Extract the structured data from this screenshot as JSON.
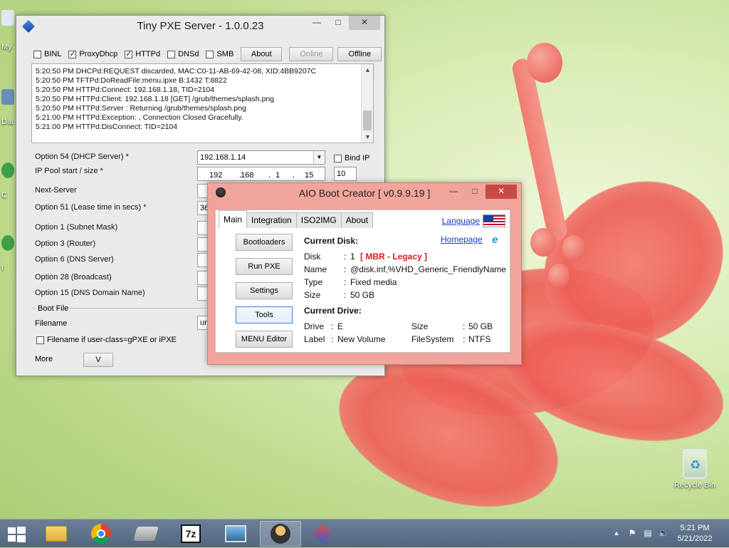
{
  "desktop": {
    "recycle_bin_label": "Recycle Bin",
    "left_fragments": [
      "My",
      "Dat",
      "C",
      "C",
      "I",
      "D"
    ]
  },
  "pxe_window": {
    "title": "Tiny PXE Server - 1.0.0.23",
    "toolbar": {
      "checkboxes": [
        {
          "label": "BINL",
          "checked": false
        },
        {
          "label": "ProxyDhcp",
          "checked": true
        },
        {
          "label": "HTTPd",
          "checked": true
        },
        {
          "label": "DNSd",
          "checked": false
        },
        {
          "label": "SMB",
          "checked": false
        }
      ],
      "about_label": "About",
      "online_label": "Online",
      "offline_label": "Offline"
    },
    "log_lines": [
      "5:20:50 PM DHCPd:REQUEST discarded, MAC:C0-11-AB-69-42-08, XID:4BB9207C",
      "5:20:50 PM TFTPd:DoReadFile:menu.ipxe B:1432 T:8822",
      "5:20:50 PM HTTPd:Connect: 192.168.1.18, TID=2104",
      "5:20:50 PM HTTPd:Client: 192.168.1.18 [GET] /grub/themes/splash.png",
      "5:20:50 PM HTTPd:Server : Returning /grub/themes/splash.png",
      "5:21:00 PM HTTPd:Exception: , Connection Closed Gracefully.",
      "5:21:00 PM HTTPd:DisConnect: TID=2104"
    ],
    "options": {
      "opt54_label": "Option 54 (DHCP Server) *",
      "opt54_value": "192.168.1.14",
      "bind_ip_label": "Bind IP",
      "ip_pool_label": "IP Pool start / size *",
      "ip_pool_octets": [
        "192",
        "168",
        "1",
        "15"
      ],
      "ip_pool_size": "10",
      "next_server_label": "Next-Server",
      "opt51_label": "Option 51 (Lease time in secs) *",
      "opt51_value": "36",
      "opt1_label": "Option 1  (Subnet Mask)",
      "opt3_label": "Option 3  (Router)",
      "opt6_label": "Option 6  (DNS Server)",
      "opt28_label": "Option 28 (Broadcast)",
      "opt15_label": "Option 15 (DNS Domain Name)"
    },
    "boot_file": {
      "section_label": "Boot File",
      "filename_label": "Filename",
      "filename_value": "un",
      "userclass_label": "Filename if user-class=gPXE or iPXE"
    },
    "more_label": "More",
    "more_button": "V"
  },
  "aio_window": {
    "title": "AIO Boot Creator [ v0.9.9.19 ]",
    "tabs": [
      "Main",
      "Integration",
      "ISO2IMG",
      "About"
    ],
    "language_label": "Language",
    "homepage_label": "Homepage",
    "side_buttons": [
      "Bootloaders",
      "Run PXE",
      "Settings",
      "Tools",
      "MENU Editor"
    ],
    "current_disk": {
      "heading": "Current Disk:",
      "disk_label": "Disk",
      "disk_value": "1",
      "disk_type": "[ MBR - Legacy ]",
      "name_label": "Name",
      "name_value": "@disk.inf,%VHD_Generic_FriendlyName",
      "type_label": "Type",
      "type_value": "Fixed media",
      "size_label": "Size",
      "size_value": "50 GB"
    },
    "current_drive": {
      "heading": "Current Drive:",
      "drive_label": "Drive",
      "drive_value": "E",
      "size_label": "Size",
      "size_value": "50 GB",
      "label_label": "Label",
      "label_value": "New Volume",
      "fs_label": "FileSystem",
      "fs_value": "NTFS"
    },
    "colors": {
      "accent_red": "#d81b1b",
      "link": "#1c3fc8"
    }
  },
  "taskbar": {
    "items": [
      "file-explorer",
      "chrome",
      "hard-drive-tool",
      "7zip",
      "image-viewer",
      "aio-boot-creator",
      "tiny-pxe-server"
    ],
    "active_item": "aio-boot-creator",
    "clock_time": "5:21 PM",
    "clock_date": "5/21/2022"
  }
}
